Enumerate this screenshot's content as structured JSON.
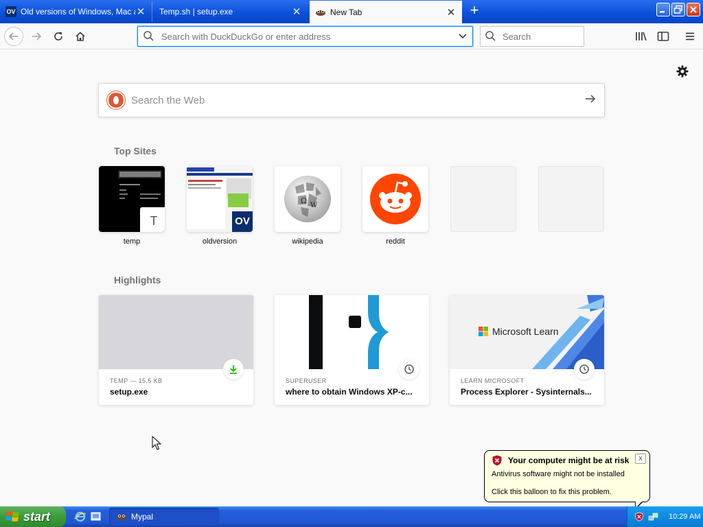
{
  "browser": {
    "tabs": [
      {
        "favicon": "ov-logo",
        "title": "Old versions of Windows, Mac and Linux software",
        "active": false
      },
      {
        "favicon": "temp-sh",
        "title": "Temp.sh | setup.exe",
        "active": false
      },
      {
        "favicon": "firefox-icon",
        "title": "New Tab",
        "active": true
      }
    ],
    "new_tab_symbol": "+",
    "window_controls": {
      "minimize": "_",
      "maximize": "□",
      "close": "✕"
    }
  },
  "navbar": {
    "url_placeholder": "Search with DuckDuckGo or enter address",
    "search_placeholder": "Search"
  },
  "newtab": {
    "web_search_placeholder": "Search the Web",
    "top_sites_title": "Top Sites",
    "top_sites": [
      {
        "label": "temp",
        "badge": "T"
      },
      {
        "label": "oldversion",
        "badge": "OV"
      },
      {
        "label": "wikipedia"
      },
      {
        "label": "reddit"
      },
      {
        "label": ""
      },
      {
        "label": ""
      }
    ],
    "highlights_title": "Highlights",
    "highlights": [
      {
        "context": "TEMP — 15.5 KB",
        "title": "setup.exe",
        "badge_icon": "download-icon"
      },
      {
        "context": "SUPERUSER",
        "title": "where to obtain Windows XP-c...",
        "badge_icon": "clock-icon"
      },
      {
        "context": "LEARN MICROSOFT",
        "title": "Process Explorer - Sysinternals...",
        "badge_icon": "clock-icon",
        "thumb_text": "Microsoft Learn"
      }
    ]
  },
  "balloon": {
    "title": "Your computer might be at risk",
    "line1": "Antivirus software might not be installed",
    "line2": "Click this balloon to fix this problem.",
    "close": "x"
  },
  "taskbar": {
    "start_label": "start",
    "task_label": "Mypal",
    "clock": "10:29 AM"
  },
  "colors": {
    "accent": "#0a84ff",
    "reddit": "#ff4500",
    "ddg": "#de5833",
    "xp_blue": "#245edb",
    "xp_green": "#3c9b3a"
  }
}
